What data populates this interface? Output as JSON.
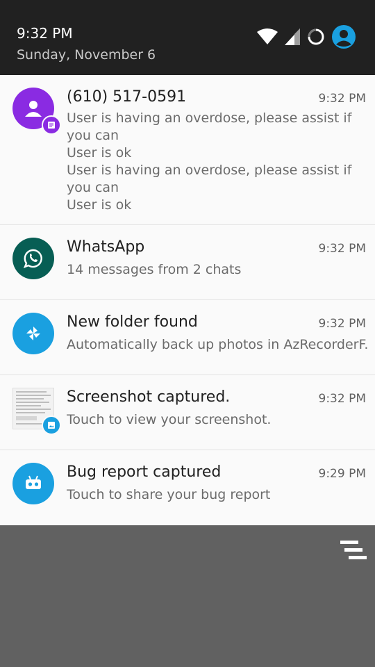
{
  "status_bar": {
    "time": "9:32 PM",
    "date": "Sunday, November 6",
    "icons": [
      "wifi-icon",
      "cell-signal-icon",
      "loading-circle-icon",
      "account-icon"
    ]
  },
  "notifications": [
    {
      "icon": "contact-icon",
      "badge_icon": "message-icon",
      "title": "(610) 517-0591",
      "time": "9:32 PM",
      "lines": [
        "User is having an overdose, please assist if you can",
        "User is ok",
        "User is having an overdose, please assist if you can",
        "User is ok"
      ]
    },
    {
      "icon": "whatsapp-icon",
      "title": "WhatsApp",
      "time": "9:32 PM",
      "text": "14 messages from 2 chats"
    },
    {
      "icon": "pinwheel-icon",
      "title": "New folder found",
      "time": "9:32 PM",
      "text": "Automatically back up photos in AzRecorderF.."
    },
    {
      "icon": "screenshot-thumbnail",
      "badge_icon": "image-icon",
      "title": "Screenshot captured.",
      "time": "9:32 PM",
      "text": "Touch to view your screenshot."
    },
    {
      "icon": "android-bug-icon",
      "title": "Bug report captured",
      "time": "9:29 PM",
      "text": "Touch to share your bug report"
    }
  ],
  "clear_all_icon": "clear-all-icon",
  "colors": {
    "header_bg": "#212121",
    "panel_bg": "#fafafa",
    "backdrop": "#616161",
    "accent_blue": "#1aa0e0",
    "purple": "#8a2be2",
    "whatsapp_green": "#075e54"
  }
}
